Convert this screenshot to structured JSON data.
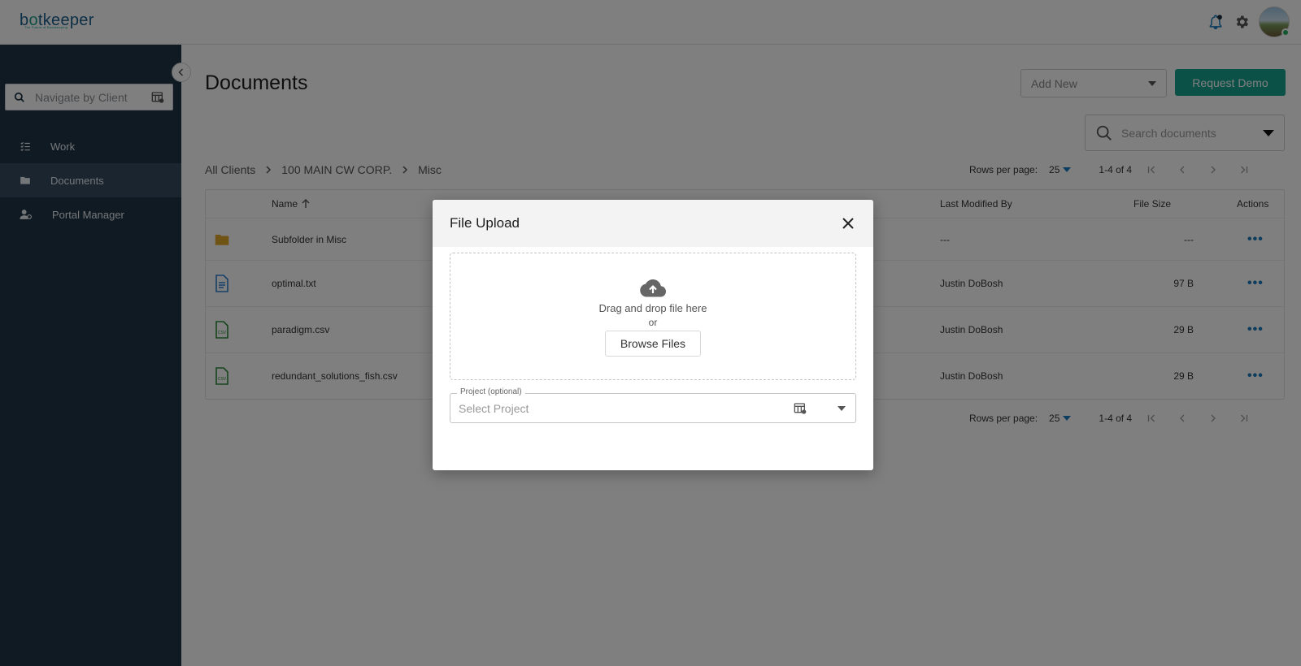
{
  "header": {
    "logo_prefix": "b",
    "logo_o": "o",
    "logo_rest": "tkeeper",
    "logo_tagline": "The Future of Bookkeeping",
    "icons": [
      "bell-icon",
      "gear-icon",
      "avatar"
    ]
  },
  "sidebar": {
    "search_placeholder": "Navigate by Client",
    "items": [
      {
        "label": "Work",
        "icon": "checklist-icon"
      },
      {
        "label": "Documents",
        "icon": "folder-icon"
      },
      {
        "label": "Portal Manager",
        "icon": "user-settings-icon"
      }
    ]
  },
  "main": {
    "title": "Documents",
    "add_new_label": "Add New",
    "request_demo_label": "Request Demo",
    "search_placeholder": "Search documents",
    "breadcrumb": [
      "All Clients",
      "100 MAIN CW CORP.",
      "Misc"
    ],
    "pager": {
      "rows_per_page_label": "Rows per page:",
      "rows_per_page_value": "25",
      "range": "1-4 of 4"
    },
    "table": {
      "columns": {
        "name": "Name",
        "last_modified_by": "Last Modified By",
        "file_size": "File Size",
        "actions": "Actions"
      },
      "rows": [
        {
          "type": "folder",
          "name": "Subfolder in Misc",
          "modified_by": "---",
          "size": "---"
        },
        {
          "type": "txt",
          "name": "optimal.txt",
          "modified_by": "Justin DoBosh",
          "size": "97 B"
        },
        {
          "type": "csv",
          "name": "paradigm.csv",
          "modified_by": "Justin DoBosh",
          "size": "29 B"
        },
        {
          "type": "csv",
          "name": "redundant_solutions_fish.csv",
          "modified_by": "Justin DoBosh",
          "size": "29 B"
        }
      ],
      "actions_glyph": "•••"
    }
  },
  "modal": {
    "title": "File Upload",
    "dropzone_text": "Drag and drop file here",
    "dropzone_or": "or",
    "browse_label": "Browse Files",
    "project_legend": "Project (optional)",
    "project_placeholder": "Select Project"
  },
  "colors": {
    "sidebar": "#1f3447",
    "sidebar_active": "#344a5e",
    "accent": "#18a38e",
    "link": "#1b7bbd",
    "folder": "#e0a92a",
    "txt": "#2f7fd0",
    "csv": "#2a8a3a"
  }
}
